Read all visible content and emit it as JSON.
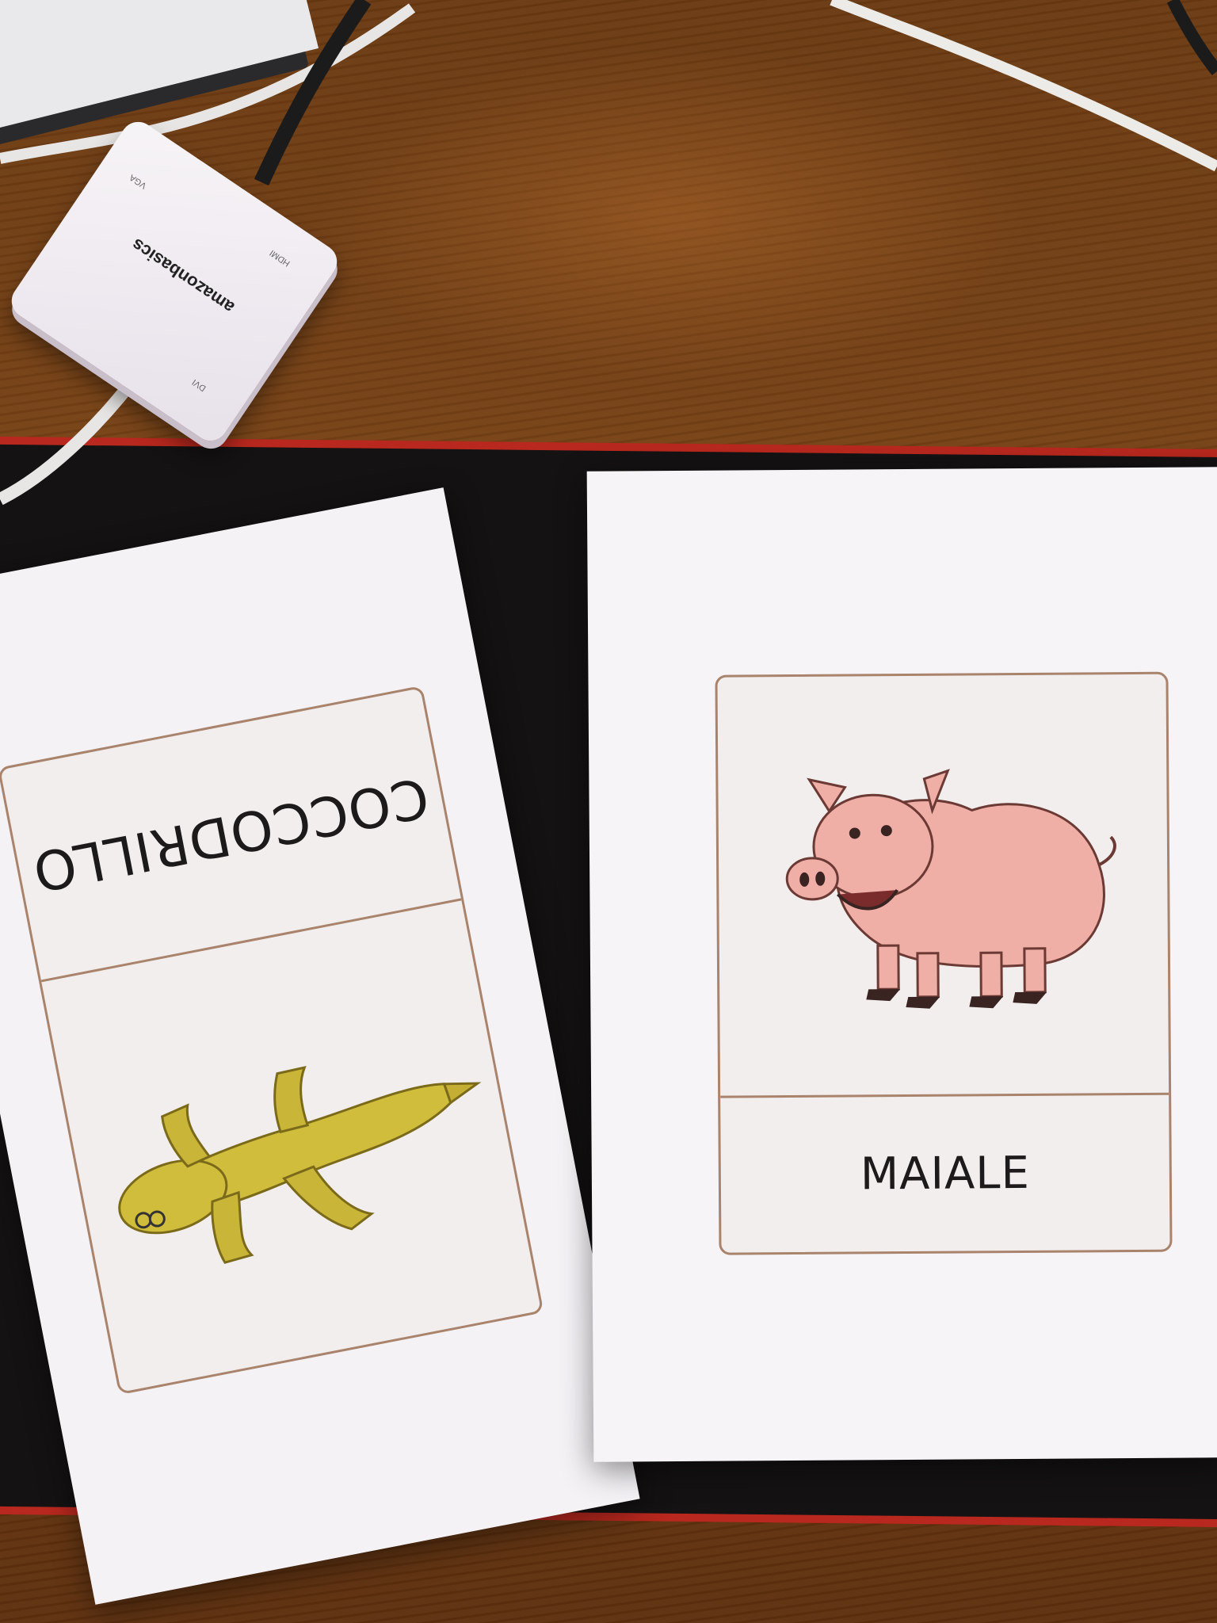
{
  "scene": {
    "description_colors": {
      "desk": "#6e3b13",
      "mat": "#141212",
      "mat_border": "#b8281e",
      "paper": "#f4f2f5",
      "card_border": "#a9836b"
    }
  },
  "adapter": {
    "brand": "amazonbasics",
    "ports": [
      "HDMI",
      "VGA",
      "DVI"
    ]
  },
  "cards": [
    {
      "label": "COCCODRILLO",
      "illustration": "crocodile",
      "orientation": "upside-down",
      "color": "#c9b63a"
    },
    {
      "label": "MAIALE",
      "illustration": "pig",
      "orientation": "upright",
      "color": "#e9a6a0"
    }
  ]
}
